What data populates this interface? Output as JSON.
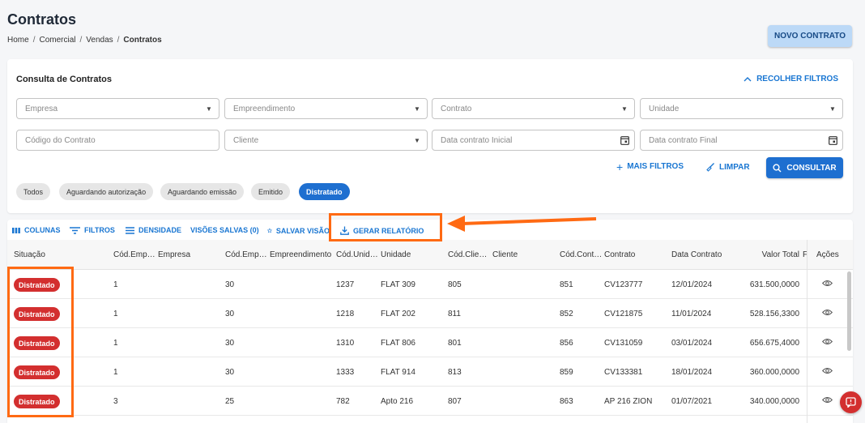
{
  "header": {
    "title": "Contratos",
    "breadcrumb": [
      "Home",
      "Comercial",
      "Vendas",
      "Contratos"
    ],
    "new_button": "NOVO CONTRATO"
  },
  "filters": {
    "title": "Consulta de Contratos",
    "collapse_label": "RECOLHER FILTROS",
    "empresa_placeholder": "Empresa",
    "empreendimento_placeholder": "Empreendimento",
    "contrato_placeholder": "Contrato",
    "unidade_placeholder": "Unidade",
    "codigo_placeholder": "Código do Contrato",
    "cliente_placeholder": "Cliente",
    "data_inicial_placeholder": "Data contrato Inicial",
    "data_final_placeholder": "Data contrato Final",
    "mais_filtros": "MAIS FILTROS",
    "limpar": "LIMPAR",
    "consultar": "CONSULTAR",
    "status_chips": [
      "Todos",
      "Aguardando autorização",
      "Aguardando emissão",
      "Emitido",
      "Distratado"
    ],
    "active_chip": "Distratado"
  },
  "toolbar": {
    "colunas": "COLUNAS",
    "filtros": "FILTROS",
    "densidade": "DENSIDADE",
    "visoes_salvas": "VISÕES SALVAS (0)",
    "salvar_visao": "SALVAR VISÃO",
    "gerar_relatorio": "GERAR RELATÓRIO"
  },
  "table": {
    "columns": [
      "Situação",
      "Cód.Emp…",
      "Empresa",
      "Cód.Emp…",
      "Empreendimento",
      "Cód.Unid…",
      "Unidade",
      "Cód.Clie…",
      "Cliente",
      "Cód.Cont…",
      "Contrato",
      "Data Contrato",
      "Valor Total",
      "F",
      "Ações"
    ],
    "rows": [
      {
        "situacao": "Distratado",
        "cod_empresa": "1",
        "cod_empreend": "30",
        "cod_unidade": "1237",
        "unidade": "FLAT 309",
        "cod_cliente": "805",
        "cod_contrato": "851",
        "contrato": "CV123777",
        "data": "12/01/2024",
        "valor": "631.500,0000"
      },
      {
        "situacao": "Distratado",
        "cod_empresa": "1",
        "cod_empreend": "30",
        "cod_unidade": "1218",
        "unidade": "FLAT 202",
        "cod_cliente": "811",
        "cod_contrato": "852",
        "contrato": "CV121875",
        "data": "11/01/2024",
        "valor": "528.156,3300"
      },
      {
        "situacao": "Distratado",
        "cod_empresa": "1",
        "cod_empreend": "30",
        "cod_unidade": "1310",
        "unidade": "FLAT 806",
        "cod_cliente": "801",
        "cod_contrato": "856",
        "contrato": "CV131059",
        "data": "03/01/2024",
        "valor": "656.675,4000"
      },
      {
        "situacao": "Distratado",
        "cod_empresa": "1",
        "cod_empreend": "30",
        "cod_unidade": "1333",
        "unidade": "FLAT 914",
        "cod_cliente": "813",
        "cod_contrato": "859",
        "contrato": "CV133381",
        "data": "18/01/2024",
        "valor": "360.000,0000"
      },
      {
        "situacao": "Distratado",
        "cod_empresa": "3",
        "cod_empreend": "25",
        "cod_unidade": "782",
        "unidade": "Apto 216",
        "cod_cliente": "807",
        "cod_contrato": "863",
        "contrato": "AP 216 ZION",
        "data": "01/07/2021",
        "valor": "340.000,0000"
      }
    ]
  },
  "colors": {
    "primary": "#1e6fd0",
    "badge_red": "#d32f2f",
    "highlight_orange": "#ff6a13"
  }
}
